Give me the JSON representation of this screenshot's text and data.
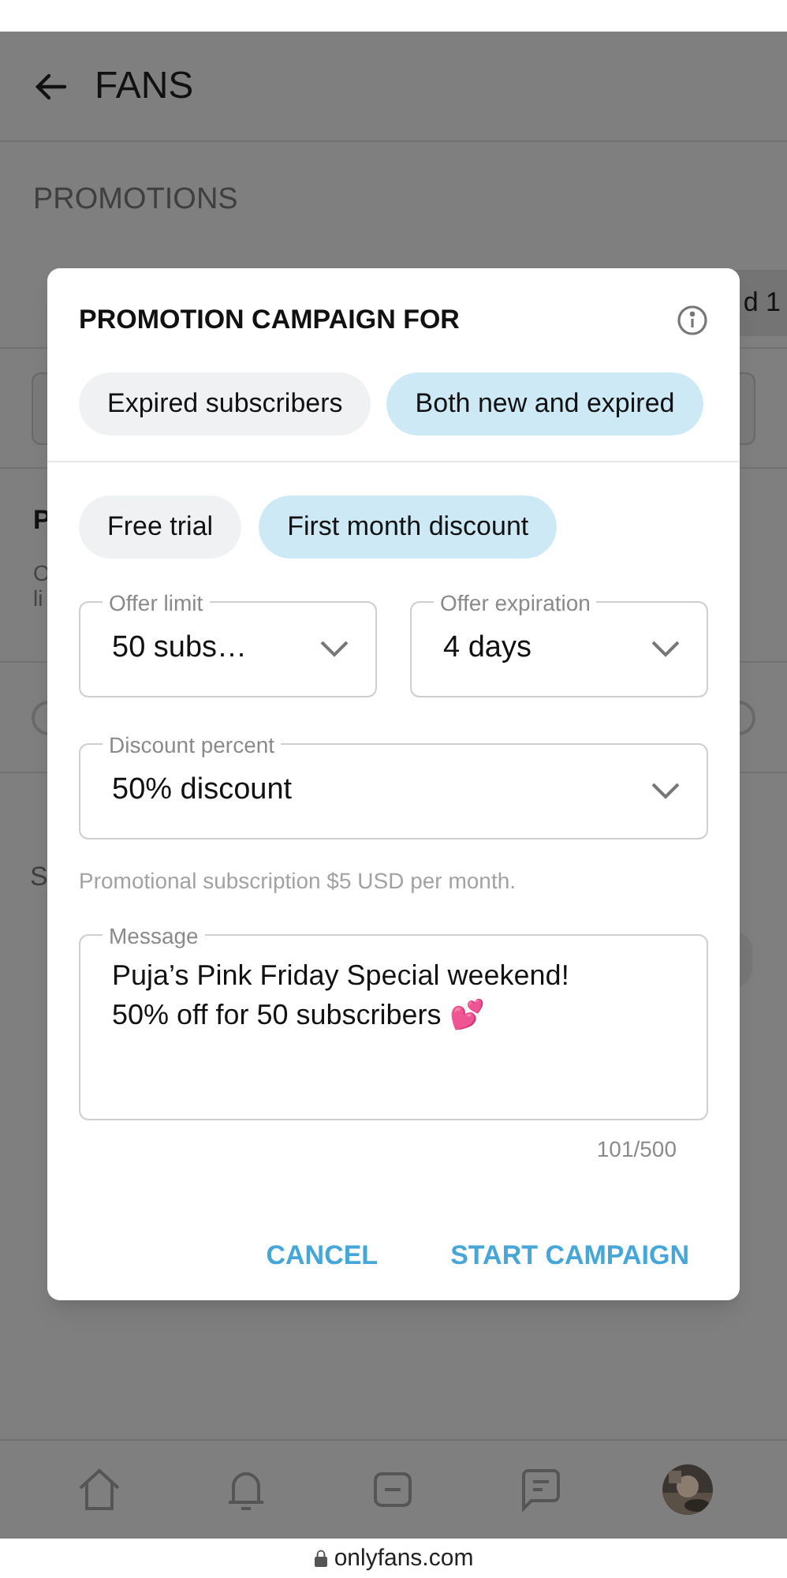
{
  "header": {
    "title": "FANS"
  },
  "section_title": "PROMOTIONS",
  "background_fragments": {
    "chip": "d 1",
    "heading": "P",
    "description": [
      "O",
      "li"
    ],
    "section": "S"
  },
  "modal": {
    "title": "PROMOTION CAMPAIGN FOR",
    "audience_options": [
      {
        "label": "Expired subscribers",
        "selected": false
      },
      {
        "label": "Both new and expired",
        "selected": true
      }
    ],
    "offer_types": [
      {
        "label": "Free trial",
        "selected": false
      },
      {
        "label": "First month discount",
        "selected": true
      }
    ],
    "fields": [
      {
        "label": "Offer limit",
        "value": "50 subs…"
      },
      {
        "label": "Offer expiration",
        "value": "4 days"
      },
      {
        "label": "Discount percent",
        "value": "50% discount"
      }
    ],
    "helper_text": "Promotional subscription $5 USD per month.",
    "message": {
      "label": "Message",
      "lines": [
        "Puja’s Pink Friday Special weekend!",
        "50% off for 50 subscribers 💕"
      ]
    },
    "counter": "101/500",
    "buttons": [
      {
        "label": "CANCEL"
      },
      {
        "label": "START CAMPAIGN"
      }
    ]
  },
  "address_bar": {
    "url": "onlyfans.com"
  }
}
